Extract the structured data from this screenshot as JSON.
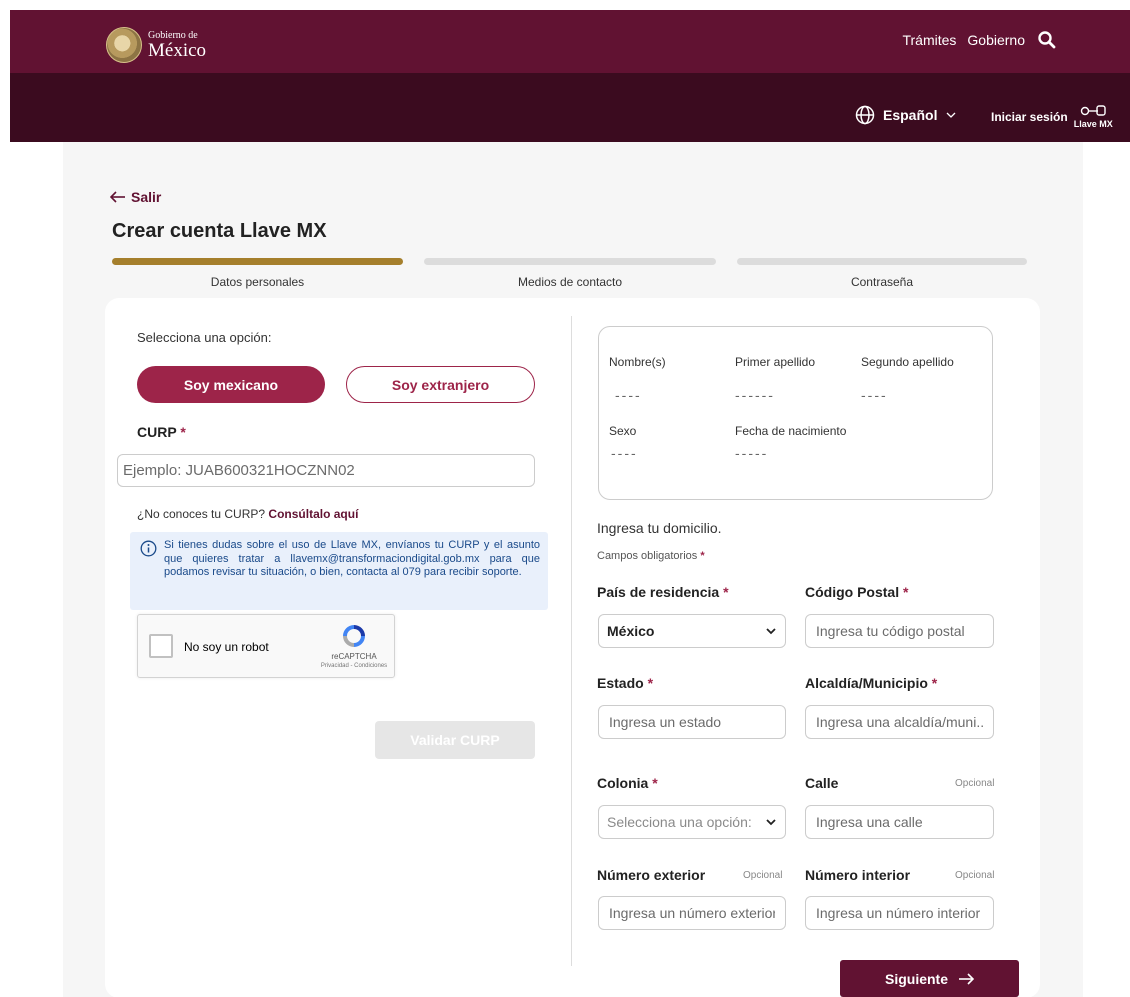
{
  "header": {
    "logo_small": "Gobierno de",
    "logo_big": "México",
    "nav": [
      "Trámites",
      "Gobierno"
    ],
    "language": "Español",
    "login_label": "Iniciar sesión",
    "llave_logo_text": "Llave MX"
  },
  "page": {
    "back_label": "Salir",
    "title": "Crear cuenta Llave MX",
    "steps": [
      "Datos personales",
      "Medios de contacto",
      "Contraseña"
    ],
    "active_step": 1
  },
  "left": {
    "select_label": "Selecciona una opción:",
    "btn_mexicano": "Soy mexicano",
    "btn_extranjero": "Soy extranjero",
    "curp_label": "CURP",
    "required_mark": "*",
    "curp_placeholder": "Ejemplo: JUAB600321HOCZNN02",
    "curp_help_text": "¿No conoces tu CURP?",
    "curp_help_link": "Consúltalo aquí",
    "info_text": "Si tienes dudas sobre el uso de Llave MX, envíanos tu CURP y el asunto que quieres tratar a llavemx@transformaciondigital.gob.mx para que podamos revisar tu situación, o bien, contacta al 079 para recibir soporte.",
    "captcha_label": "No soy un robot",
    "captcha_brand": "reCAPTCHA",
    "captcha_links": "Privacidad - Condiciones",
    "validate_button": "Validar CURP"
  },
  "summary": {
    "nombre_label": "Nombre(s)",
    "nombre_value": "----",
    "primer_label": "Primer apellido",
    "primer_value": "------",
    "segundo_label": "Segundo apellido",
    "segundo_value": "----",
    "sexo_label": "Sexo",
    "sexo_value": "----",
    "fecha_label": "Fecha de nacimiento",
    "fecha_value": "-----"
  },
  "address": {
    "heading": "Ingresa tu domicilio.",
    "required_note": "Campos obligatorios",
    "optional_label": "Opcional",
    "pais_label": "País de residencia",
    "pais_value": "México",
    "cp_label": "Código Postal",
    "cp_placeholder": "Ingresa tu código postal",
    "estado_label": "Estado",
    "estado_placeholder": "Ingresa un estado",
    "alcaldia_label": "Alcaldía/Municipio",
    "alcaldia_placeholder": "Ingresa una alcaldía/muni...",
    "colonia_label": "Colonia",
    "colonia_placeholder": "Selecciona una opción:",
    "calle_label": "Calle",
    "calle_placeholder": "Ingresa una calle",
    "num_ext_label": "Número exterior",
    "num_ext_placeholder": "Ingresa un número exterior",
    "num_int_label": "Número interior",
    "num_int_placeholder": "Ingresa un número interior"
  },
  "footer": {
    "next_button": "Siguiente"
  },
  "colors": {
    "brand_dark": "#611232",
    "brand": "#9d2449",
    "gold": "#a57f2c"
  }
}
